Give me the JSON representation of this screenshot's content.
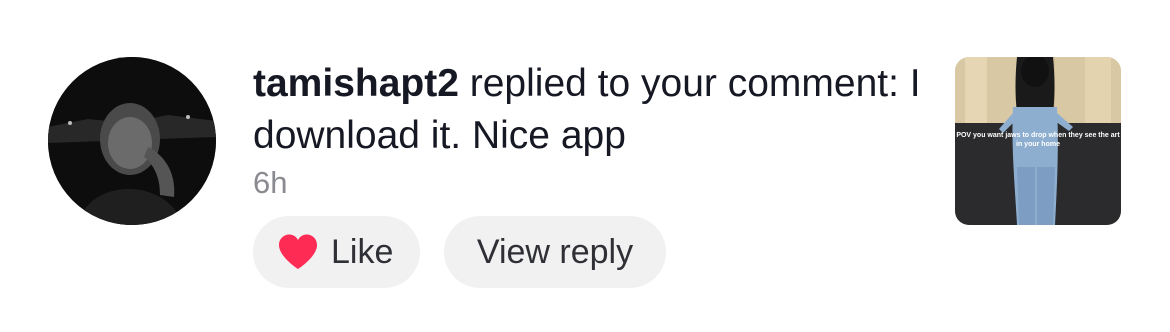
{
  "notification": {
    "username": "tamishapt2",
    "action_text": " replied to your comment: I download it. Nice app",
    "time": "6h"
  },
  "actions": {
    "like_label": "Like",
    "view_reply_label": "View reply"
  },
  "thumbnail": {
    "caption": "POV you want jaws to drop when they see the art in your home"
  },
  "colors": {
    "heart": "#fe2c55",
    "pill_bg": "#f1f1f2",
    "text": "#161823",
    "muted": "#8a8b91"
  },
  "icons": {
    "like": "heart-icon"
  }
}
